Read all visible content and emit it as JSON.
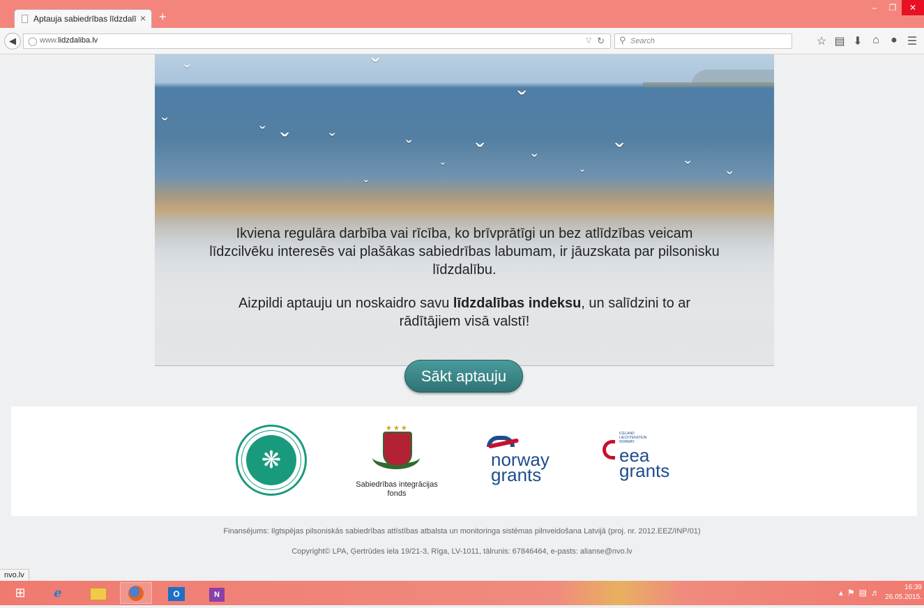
{
  "browser": {
    "tab_title": "Aptauja sabiedrības līdzdalī...",
    "tab_close": "×",
    "new_tab": "+",
    "url_prefix": "www.",
    "url_domain": "lidzdaliba.lv",
    "search_placeholder": "Search",
    "window_controls": {
      "minimize": "–",
      "restore": "❐",
      "close": "✕"
    },
    "toolbar_icons": [
      "star-icon",
      "reading-list-icon",
      "download-icon",
      "home-icon",
      "chat-icon",
      "menu-icon"
    ]
  },
  "hero": {
    "paragraph1": "Ikviena regulāra darbība vai rīcība, ko brīvprātīgi un bez atlīdzības veicam līdzcilvēku interesēs vai plašākas sabiedrības labumam, ir jāuzskata par pilsonisku līdzdalību.",
    "paragraph2_before": "Aizpildi aptauju un noskaidro savu ",
    "paragraph2_bold": "līdzdalības indeksu",
    "paragraph2_after": ", un salīdzini to ar rādītājiem visā valstī!"
  },
  "start_button": "Sākt aptauju",
  "logos": {
    "sif_caption_line1": "Sabiedrības integrācijas",
    "sif_caption_line2": "fonds",
    "norway_line1": "norway",
    "norway_line2": "grants",
    "eea_countries": [
      "ICELAND",
      "LIECHTENSTEIN",
      "NORWAY"
    ],
    "eea_line1": "eea",
    "eea_line2": "grants"
  },
  "footer": {
    "funding": "Finansējums: Ilgtspējas pilsoniskās sabiedrības attīstības atbalsta un monitoringa sistēmas pilnveidošana Latvijā (proj. nr. 2012.EEZ/INP/01)",
    "copyright": "Copyright© LPA, Ģertrūdes iela 19/21-3, Rīga, LV-1011, tālrunis: 67846464, e-pasts: alianse@nvo.lv"
  },
  "status_bar_url": "nvo.lv",
  "taskbar": {
    "clock_time": "16:39",
    "clock_date": "26.05.2015."
  },
  "colors": {
    "browser_chrome": "#f4857c",
    "button_teal": "#2e7375",
    "logo_green": "#1a9a7c",
    "grants_blue": "#1e4d8c",
    "grants_red": "#c8102e"
  }
}
